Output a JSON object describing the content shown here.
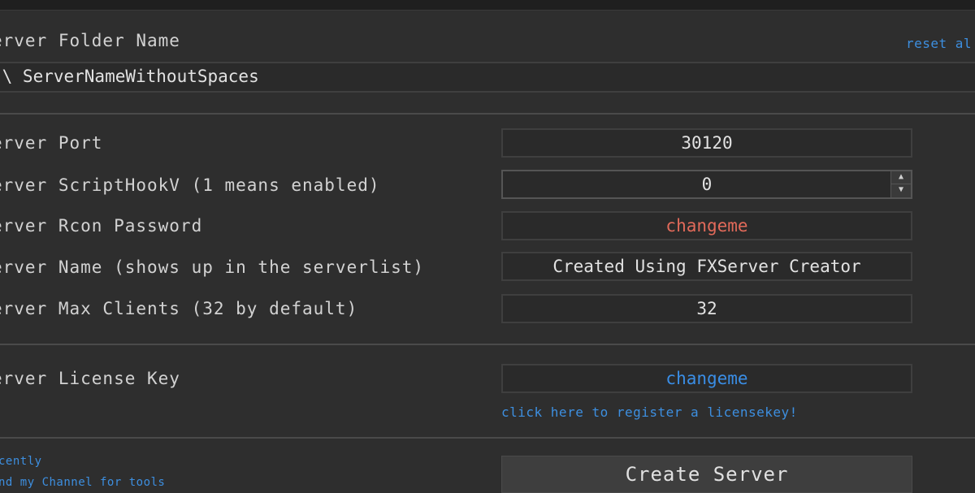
{
  "form": {
    "folder_label": "erver Folder Name",
    "reset_link": "reset al",
    "folder_value": ":\\ ServerNameWithoutSpaces",
    "port_label": "erver Port",
    "port_value": "30120",
    "scripthook_label": "erver ScriptHookV (1 means enabled)",
    "scripthook_value": "0",
    "rcon_label": "erver Rcon Password",
    "rcon_value": "changeme",
    "name_label": "erver Name (shows up in the serverlist)",
    "name_value": "Created Using FXServer Creator",
    "maxclients_label": "erver Max Clients (32 by default)",
    "maxclients_value": "32",
    "license_label": "erver License Key",
    "license_value": "changeme",
    "register_link": "click here to register a licensekey!"
  },
  "footer": {
    "link1": "cently",
    "link2": "nd my Channel for tools",
    "create_button": "Create Server"
  },
  "colors": {
    "background": "#2e2e2e",
    "link": "#3d8fe0",
    "rcon_value": "#e26a5a",
    "license_value": "#3a8ee6"
  },
  "icons": {
    "spinner": "up-down-arrows-icon"
  }
}
